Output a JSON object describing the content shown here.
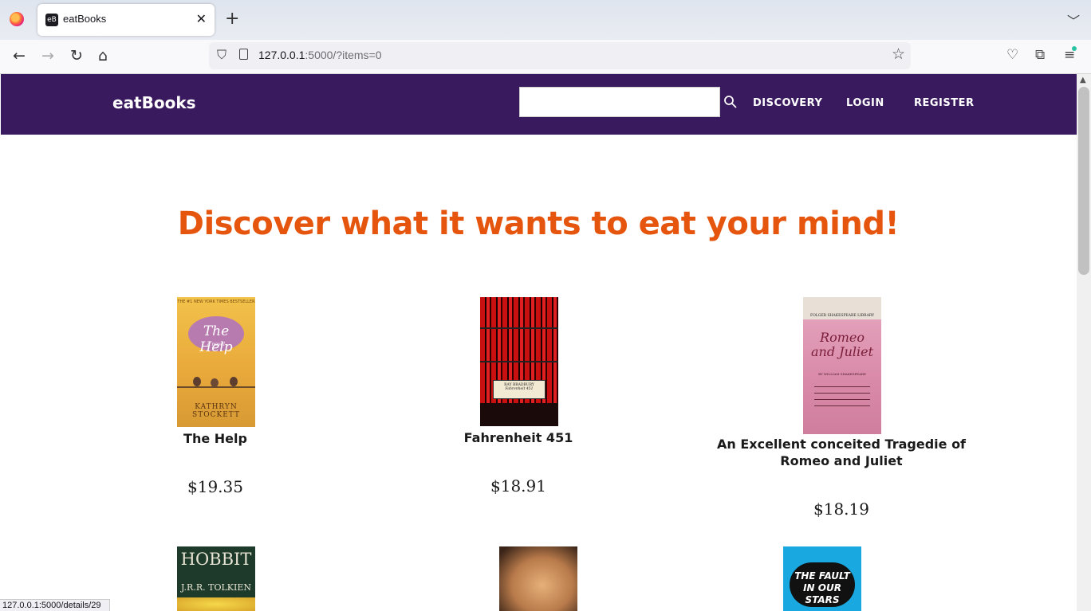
{
  "browser": {
    "tab_title": "eatBooks",
    "tab_favicon": "eB",
    "url_host": "127.0.0.1",
    "url_rest": ":5000/?items=0",
    "status_url": "127.0.0.1:5000/details/29"
  },
  "header": {
    "brand": "eatBooks",
    "search_value": "",
    "nav": [
      "DISCOVERY",
      "LOGIN",
      "REGISTER"
    ]
  },
  "main": {
    "headline": "Discover what it wants to eat your mind!",
    "books": [
      {
        "title": "The Help",
        "price": "$19.35",
        "cover_top_text": "THE #1 NEW YORK TIMES BESTSELLER",
        "cover_title": "The Help",
        "cover_subtitle": "a novel",
        "cover_author": "KATHRYN STOCKETT"
      },
      {
        "title": "Fahrenheit 451",
        "price": "$18.91",
        "cover_author": "RAY BRADBURY",
        "cover_title": "Fahrenheit 451"
      },
      {
        "title": "An Excellent conceited Tragedie of Romeo and Juliet",
        "price": "$18.19",
        "cover_top_text": "FOLGER SHAKESPEARE LIBRARY",
        "cover_title": "Romeo and Juliet",
        "cover_author": "BY WILLIAM SHAKESPEARE"
      },
      {
        "cover_title": "HOBBIT",
        "cover_author": "J.R.R. TOLKIEN"
      },
      {},
      {
        "cover_title": "THE FAULT IN OUR STARS"
      }
    ]
  },
  "colors": {
    "header_bg": "#3a1a5e",
    "headline": "#e5550e"
  }
}
